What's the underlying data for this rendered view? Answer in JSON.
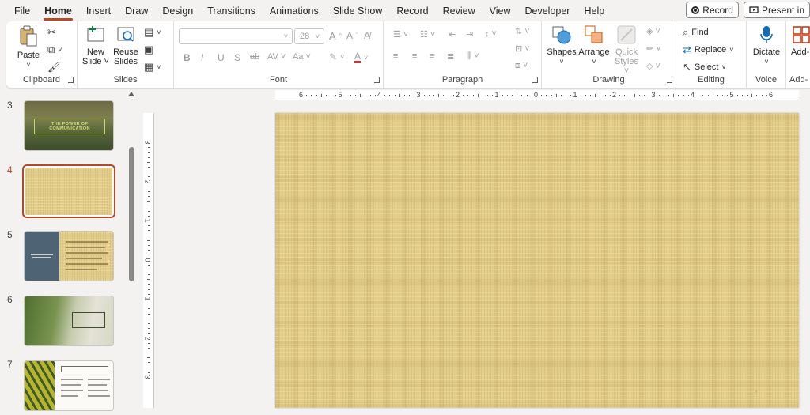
{
  "menu": {
    "tabs": [
      "File",
      "Home",
      "Insert",
      "Draw",
      "Design",
      "Transitions",
      "Animations",
      "Slide Show",
      "Record",
      "Review",
      "View",
      "Developer",
      "Help"
    ],
    "active": "Home",
    "record_label": "Record",
    "present_label": "Present in"
  },
  "ribbon": {
    "clipboard": {
      "label": "Clipboard",
      "paste": "Paste"
    },
    "slides": {
      "label": "Slides",
      "new_slide_1": "New",
      "new_slide_2": "Slide ˅",
      "reuse_1": "Reuse",
      "reuse_2": "Slides"
    },
    "font": {
      "label": "Font",
      "font_name": "",
      "font_size": "28"
    },
    "paragraph": {
      "label": "Paragraph"
    },
    "drawing": {
      "label": "Drawing",
      "shapes": "Shapes",
      "arrange": "Arrange",
      "quick_styles_1": "Quick",
      "quick_styles_2": "Styles ˅"
    },
    "editing": {
      "label": "Editing",
      "find": "Find",
      "replace": "Replace",
      "select": "Select"
    },
    "voice": {
      "label": "Voice",
      "dictate": "Dictate"
    },
    "addins": {
      "label": "Add-",
      "addins_btn": "Add-"
    }
  },
  "slides_panel": {
    "thumbnails": [
      {
        "num": "3",
        "title": "THE POWER OF COMMUNICATION",
        "active": false
      },
      {
        "num": "4",
        "title": "",
        "active": true
      },
      {
        "num": "5",
        "title": "",
        "active": false
      },
      {
        "num": "6",
        "title": "",
        "active": false
      },
      {
        "num": "7",
        "title": "",
        "active": false
      }
    ]
  },
  "rulers": {
    "horizontal": [
      "6",
      "5",
      "4",
      "3",
      "2",
      "1",
      "0",
      "1",
      "2",
      "3",
      "4",
      "5",
      "6"
    ],
    "vertical": [
      "3",
      "2",
      "1",
      "0",
      "1",
      "2",
      "3"
    ]
  },
  "slide": {
    "page_number": "4"
  },
  "colors": {
    "accent": "#b7472a",
    "slide_bg": "#e3cd8b"
  }
}
